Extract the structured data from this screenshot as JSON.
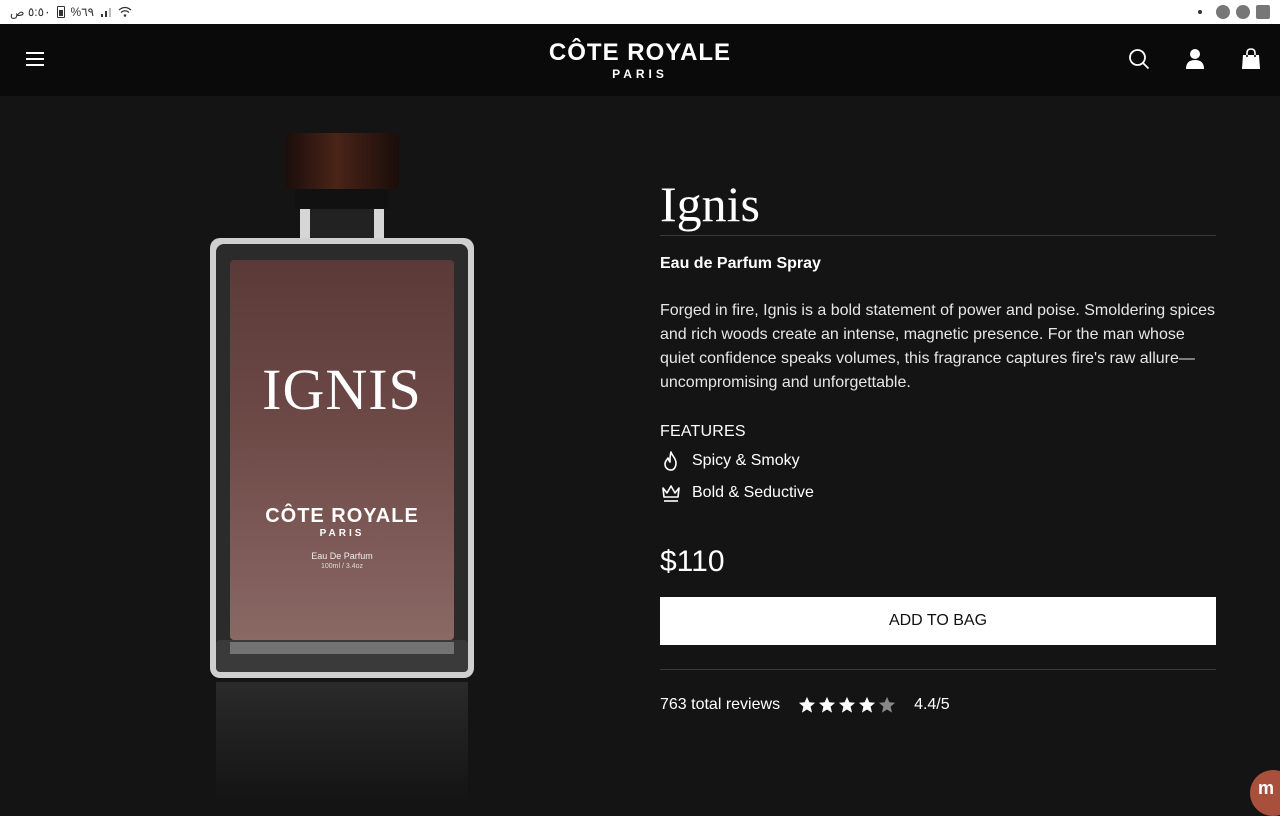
{
  "status_bar": {
    "time": "٥:٥٠ ص",
    "battery": "%٦٩"
  },
  "header": {
    "logo_main": "CÔTE ROYALE",
    "logo_sub": "PARIS"
  },
  "bottle": {
    "title": "IGNIS",
    "brand": "CÔTE ROYALE",
    "city": "PARIS",
    "type": "Eau De Parfum",
    "size": "100ml / 3.4oz"
  },
  "product": {
    "name": "Ignis",
    "type": "Eau de Parfum Spray",
    "description": "Forged in fire, Ignis is a bold statement of power and poise. Smoldering spices and rich woods create an intense, magnetic presence. For the man whose quiet confidence speaks volumes, this fragrance captures fire's raw allure—uncompromising and unforgettable.",
    "features_heading": "FEATURES",
    "features": [
      {
        "label": "Spicy & Smoky",
        "icon": "flame-icon"
      },
      {
        "label": "Bold & Seductive",
        "icon": "crown-icon"
      }
    ],
    "price": "$110",
    "add_to_bag": "ADD TO BAG",
    "reviews_text": "763 total reviews",
    "rating_text": "4.4/5",
    "rating_value": 4.4,
    "rating_max": 5
  },
  "colors": {
    "background": "#141414",
    "header": "#0a0a0a",
    "button": "#ffffff",
    "bottle_liquid": "#6e4a47"
  }
}
